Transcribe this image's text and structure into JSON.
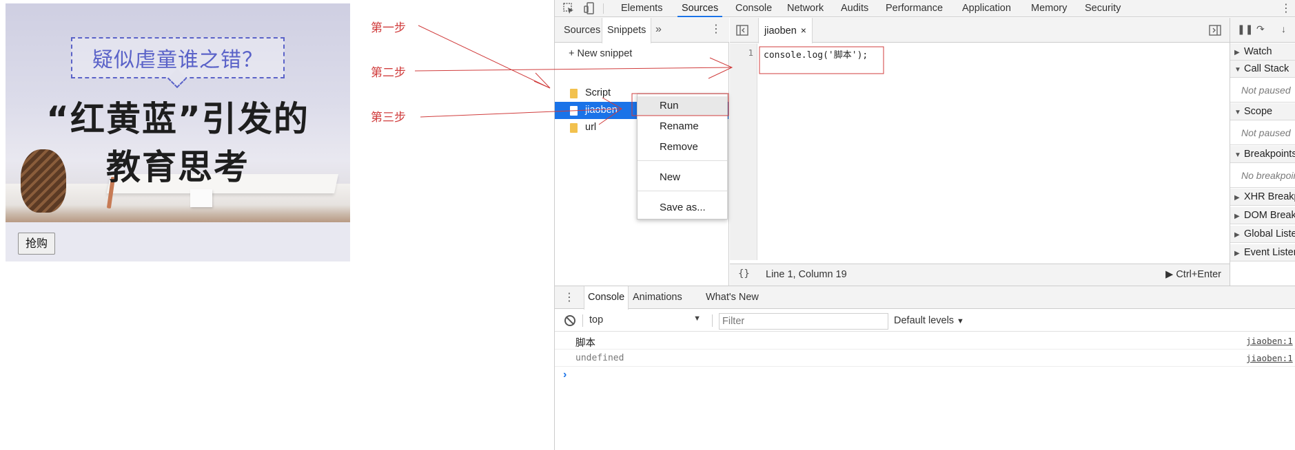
{
  "page": {
    "banner_caption": "疑似虐童谁之错？",
    "banner_title_line1": "“红黄蓝”引发的",
    "banner_title_line2": "教育思考",
    "buy_button": "抢购"
  },
  "annotations": {
    "step1": "第一步",
    "step2": "第二步",
    "step3": "第三步",
    "color": "#d03c3c"
  },
  "devtools": {
    "main_tabs": [
      "Elements",
      "Sources",
      "Console",
      "Network",
      "Audits",
      "Performance",
      "Application",
      "Memory",
      "Security"
    ],
    "active_main_tab": "Sources",
    "navigator": {
      "tabs": [
        "Sources",
        "Snippets"
      ],
      "active_tab": "Snippets",
      "more": "»",
      "new_snippet": "+ New snippet",
      "snippets": [
        "Script",
        "jiaoben",
        "url"
      ],
      "selected_snippet": "jiaoben"
    },
    "context_menu": {
      "items": [
        "Run",
        "Rename",
        "Remove",
        "New",
        "Save as..."
      ],
      "highlighted": "Run"
    },
    "editor": {
      "tab_label": "jiaoben",
      "close": "×",
      "line_number": "1",
      "code": "console.log('脚本');",
      "status_braces": "{}",
      "status_position": "Line 1, Column 19",
      "run_hint": "▶ Ctrl+Enter"
    },
    "debugger": {
      "sections": [
        "Watch",
        "Call Stack",
        "Scope",
        "Breakpoints",
        "XHR Breakpoints",
        "DOM Breakpoints",
        "Global Listeners",
        "Event Listeners"
      ],
      "call_stack_empty": "Not paused",
      "scope_empty": "Not paused",
      "breakpoints_empty": "No breakpoints"
    },
    "drawer": {
      "tabs": [
        "Console",
        "Animations",
        "What's New"
      ],
      "active_tab": "Console",
      "context": "top",
      "filter_placeholder": "Filter",
      "levels": "Default levels",
      "messages": [
        {
          "text": "脚本",
          "source": "jiaoben:1"
        },
        {
          "text": "undefined",
          "source": "jiaoben:1"
        }
      ],
      "prompt": "›"
    }
  }
}
